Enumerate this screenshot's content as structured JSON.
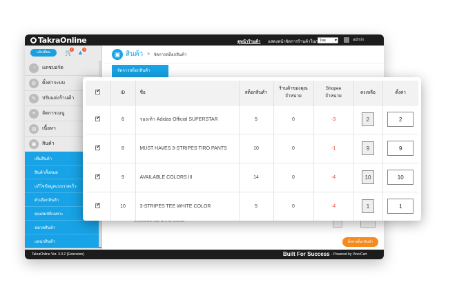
{
  "topbar": {
    "logo": "TakraOnline",
    "home_link": "ดูหน้าร้านค้า",
    "lang_label": "แสดงหน้าจัดการร้านค้าในภาษา",
    "lang_value": "ไทย",
    "user": "admin"
  },
  "sidebar": {
    "button": "แจ้งเตือน",
    "badges": [
      "0",
      "0"
    ],
    "items": [
      {
        "label": "แดชบอร์ด",
        "icon": "dashboard-icon"
      },
      {
        "label": "ตั้งค่าระบบ",
        "icon": "gear-icon"
      },
      {
        "label": "ปรับแต่งร้านค้า",
        "icon": "brush-icon"
      },
      {
        "label": "จัดการเมนู",
        "icon": "menu-icon"
      },
      {
        "label": "เนื้อหา",
        "icon": "page-icon"
      },
      {
        "label": "สินค้า",
        "icon": "box-icon"
      }
    ],
    "sub_items": [
      "เพิ่มสินค้า",
      "สินค้าทั้งหมด",
      "แก้ไขข้อมูลแบบรวดเร็ว",
      "ตัวเลือกสินค้า",
      "คุณสมบัติเฉพาะ",
      "หมวดสินค้า",
      "แผนกสินค้า"
    ]
  },
  "content": {
    "title": "สินค้า",
    "breadcrumb": "จัดการสต็อกสินค้า",
    "tab": "จัดการสต็อกสินค้า",
    "save_button": "ตั้งค่าสต็อกสินค้า",
    "bg_row_text": "3-STRIPES TEE WHITE COLOR"
  },
  "footer": {
    "version": "TakraOnline Ver. 3.3.2 (Extension)",
    "slogan": "Built For Success",
    "powered": "- Powered by VevoCart"
  },
  "table": {
    "headers": [
      "ID",
      "ชื่อ",
      "สต็อกสินค้า",
      "ร้านค้าของคุณ\nจำหน่าย",
      "Shopee\nจำหน่าย",
      "คงเหลือ",
      "ตั้งค่า"
    ],
    "rows": [
      {
        "id": "6",
        "name": "รองเท้า Adidas Official SUPERSTAR",
        "stock": "5",
        "shop_sold": "0",
        "shopee_sold": "-3",
        "remaining": "2",
        "setting": "2"
      },
      {
        "id": "8",
        "name": "MUST HAVES 3-STRIPES TIRO PANTS",
        "stock": "10",
        "shop_sold": "0",
        "shopee_sold": "-1",
        "remaining": "9",
        "setting": "9"
      },
      {
        "id": "9",
        "name": "AVAILABLE COLORS III",
        "stock": "14",
        "shop_sold": "0",
        "shopee_sold": "-4",
        "remaining": "10",
        "setting": "10"
      },
      {
        "id": "10",
        "name": "3-STRIPES TEE WHITE COLOR",
        "stock": "5",
        "shop_sold": "0",
        "shopee_sold": "-4",
        "remaining": "1",
        "setting": "1"
      }
    ]
  }
}
